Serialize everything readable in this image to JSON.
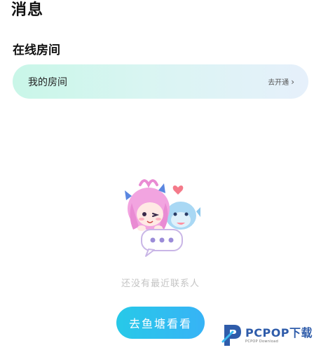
{
  "header": {
    "title": "消息"
  },
  "online_rooms": {
    "section_title": "在线房间",
    "card_label": "我的房间",
    "card_action": "去开通"
  },
  "empty_state": {
    "message": "还没有最近联系人",
    "cta_label": "去鱼塘看看"
  },
  "watermark": {
    "main": "PCPOP下载",
    "sub": "PCPOP Download"
  },
  "colors": {
    "card_gradient_start": "#c9f6e8",
    "card_gradient_end": "#e6f0fb",
    "cta_start": "#27c9e8",
    "cta_end": "#37b3f6",
    "empty_text": "#c4c4c4"
  }
}
